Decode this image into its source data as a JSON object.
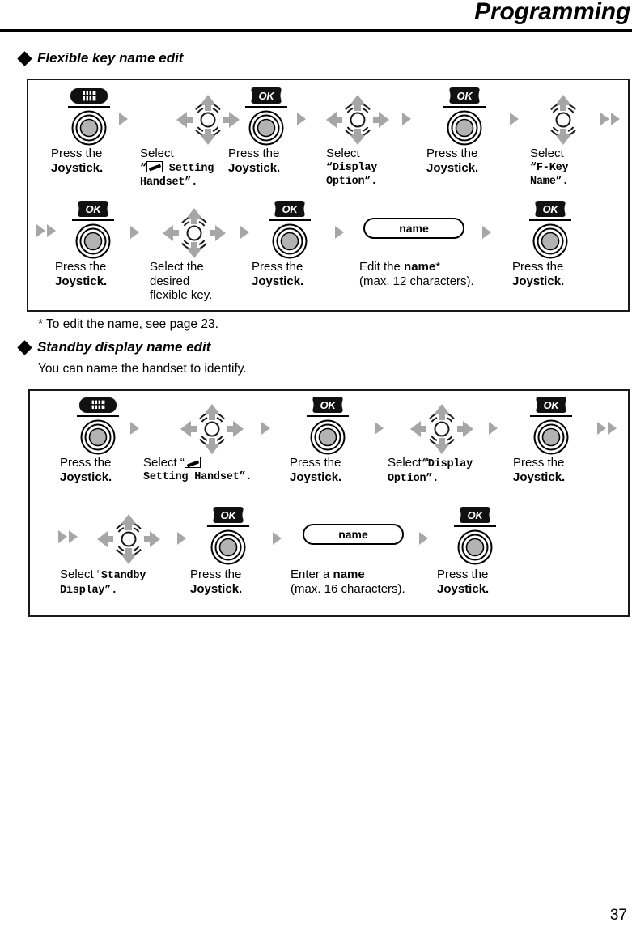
{
  "header": {
    "title": "Programming"
  },
  "sections": [
    {
      "id": "flexible-key-name-edit",
      "heading": "Flexible key name edit",
      "footnote": "* To edit the name, see page 23.",
      "rows": [
        {
          "steps": [
            {
              "icon": "menu-key-icon",
              "line1": "Press the",
              "line2": "Joystick.",
              "line1_bold": false,
              "line2_bold": true
            },
            {
              "icon": "joystick-4way-icon",
              "line1": "Select",
              "line2": "“ Setting",
              "line3": "Handset”.",
              "mono_lines": [
                2,
                3
              ]
            },
            {
              "icon": "ok-key-icon",
              "line1": "Press the",
              "line2": "Joystick.",
              "line2_bold": true
            },
            {
              "icon": "joystick-4way-icon",
              "line1": "Select",
              "line2": "“Display",
              "line3": "Option”.",
              "mono_lines": [
                2,
                3
              ]
            },
            {
              "icon": "ok-key-icon",
              "line1": "Press the",
              "line2": "Joystick.",
              "line2_bold": true
            },
            {
              "icon": "joystick-2way-icon",
              "line1": "Select",
              "line2": "“F-Key",
              "line3": "Name”.",
              "mono_lines": [
                2,
                3
              ]
            }
          ]
        },
        {
          "steps": [
            {
              "icon": "ok-key-icon",
              "line1": "Press the",
              "line2": "Joystick.",
              "line2_bold": true
            },
            {
              "icon": "joystick-4way-icon",
              "line1": "Select the",
              "line2": "desired",
              "line3": "flexible key."
            },
            {
              "icon": "ok-key-icon",
              "line1": "Press the",
              "line2": "Joystick.",
              "line2_bold": true
            },
            {
              "icon": "name-pill",
              "pill_label": "name",
              "line1": "Edit the name*",
              "line2": "(max. 12 characters)."
            },
            {
              "icon": "ok-key-icon",
              "line1": "Press the",
              "line2": "Joystick.",
              "line2_bold": true
            }
          ]
        }
      ]
    },
    {
      "id": "standby-display-name-edit",
      "heading": "Standby display name edit",
      "intro": "You can name the handset to identify.",
      "rows": [
        {
          "steps": [
            {
              "icon": "menu-key-icon",
              "line1": "Press the",
              "line2": "Joystick.",
              "line2_bold": true
            },
            {
              "icon": "joystick-4way-icon",
              "line1": "Select “",
              "line2": "Setting Handset”.",
              "mono_lines": [
                2
              ]
            },
            {
              "icon": "ok-key-icon",
              "line1": "Press the",
              "line2": "Joystick.",
              "line2_bold": true
            },
            {
              "icon": "joystick-4way-icon",
              "line1": "Select “Display",
              "line2": "Option”.",
              "mono_lines": [
                1,
                2
              ]
            },
            {
              "icon": "ok-key-icon",
              "line1": "Press the",
              "line2": "Joystick.",
              "line2_bold": true
            }
          ]
        },
        {
          "steps": [
            {
              "icon": "joystick-4way-icon",
              "line1": "Select “Standby",
              "line2": "Display”.",
              "mono_lines": [
                1,
                2
              ]
            },
            {
              "icon": "ok-key-icon",
              "line1": "Press the",
              "line2": "Joystick.",
              "line2_bold": true
            },
            {
              "icon": "name-pill",
              "pill_label": "name",
              "line1": "Enter a name",
              "line2": "(max. 16 characters)."
            },
            {
              "icon": "ok-key-icon",
              "line1": "Press the",
              "line2": "Joystick.",
              "line2_bold": true
            }
          ]
        }
      ]
    }
  ],
  "labels": {
    "press_the": "Press the",
    "joystick": "Joystick.",
    "select": "Select",
    "select_the": "Select the",
    "desired": "desired",
    "flexible_key": "flexible key.",
    "edit_the_name": "Edit the ",
    "name_bold": "name",
    "asterisk": "*",
    "max12": "(max. 12 characters).",
    "max16": "(max. 16 characters).",
    "enter_a": "Enter a ",
    "select_quote_open": "Select “",
    "setting_handset": "Setting Handset”.",
    "setting": " Setting",
    "handset": "Handset”.",
    "display_q": "“Display",
    "display_inline": "Select “Display",
    "option_q": "Option”.",
    "fkey_q": "“F-Key",
    "name_q": "Name”.",
    "standby_inline": "Select “Standby",
    "display_close": "Display”.",
    "ok": "OK",
    "name_pill": "name"
  },
  "page_number": "37",
  "colors": {
    "arrow_gray": "#a6a6a6",
    "key_fill_gray": "#b3b3b3",
    "black": "#000000"
  }
}
